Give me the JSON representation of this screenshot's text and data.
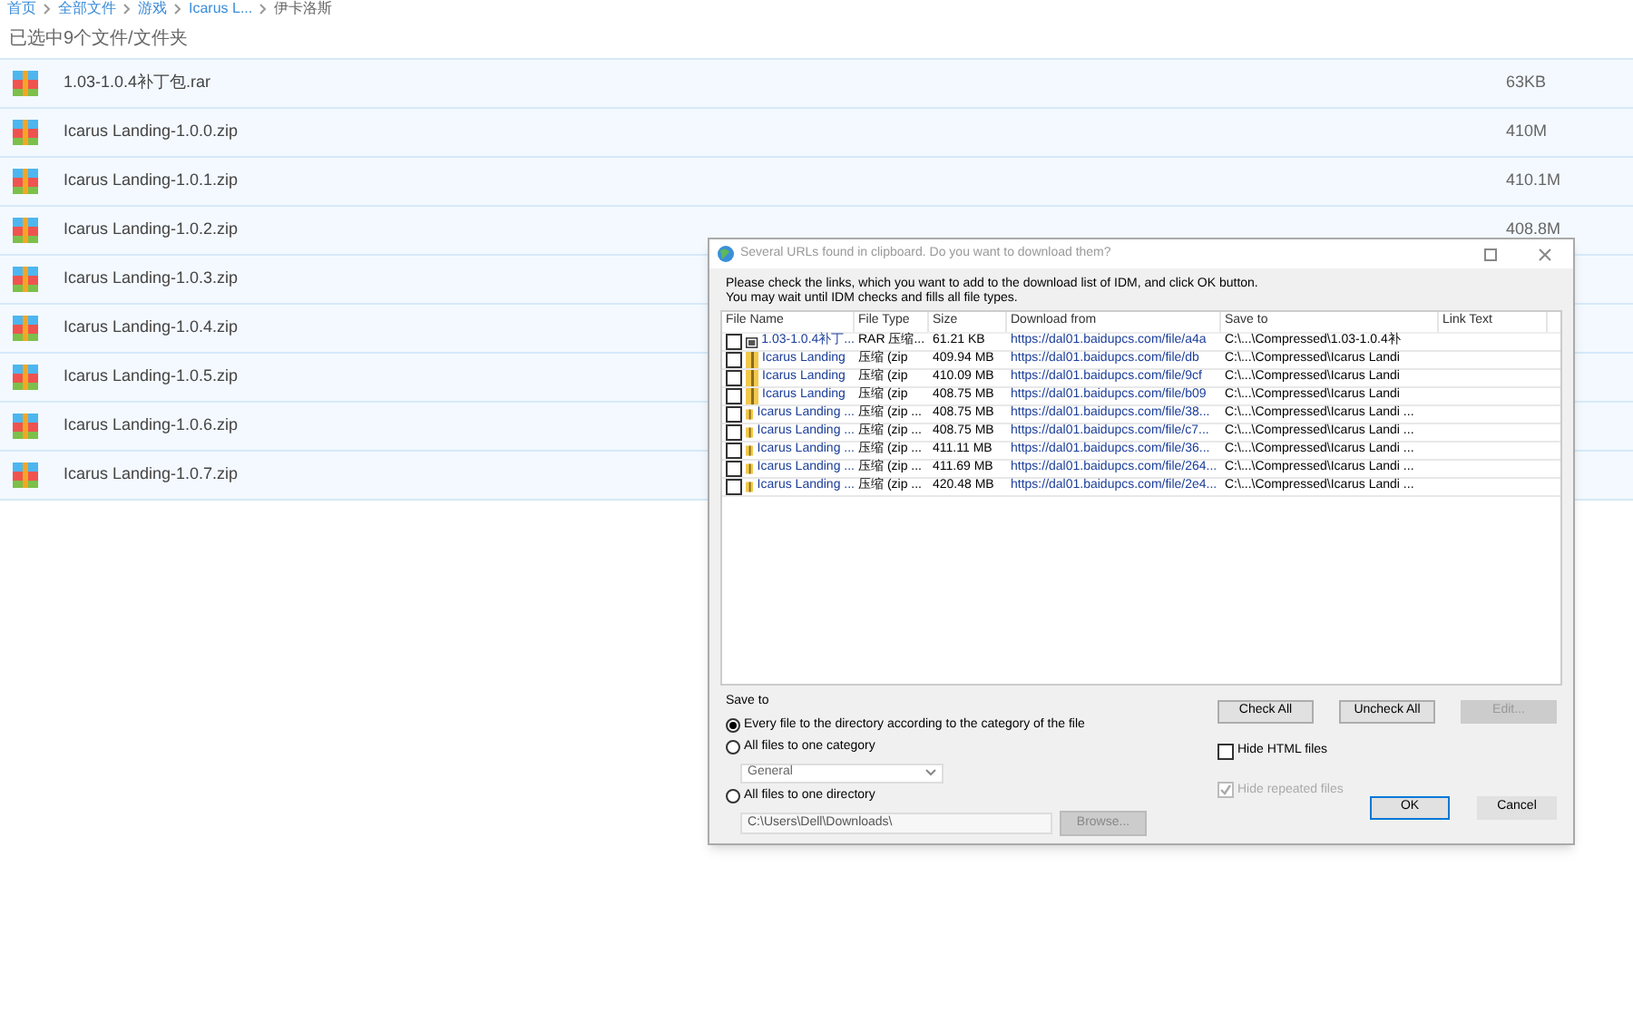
{
  "breadcrumb": [
    "首页",
    "全部文件",
    "游戏",
    "Icarus L...",
    "伊卡洛斯"
  ],
  "status": "已选中9个文件/文件夹",
  "files": [
    {
      "name": "1.03-1.0.4补丁包.rar",
      "size": "63KB"
    },
    {
      "name": "Icarus Landing-1.0.0.zip",
      "size": "410M"
    },
    {
      "name": "Icarus Landing-1.0.1.zip",
      "size": "410.1M"
    },
    {
      "name": "Icarus Landing-1.0.2.zip",
      "size": "408.8M"
    },
    {
      "name": "Icarus Landing-1.0.3.zip"
    },
    {
      "name": "Icarus Landing-1.0.4.zip"
    },
    {
      "name": "Icarus Landing-1.0.5.zip"
    },
    {
      "name": "Icarus Landing-1.0.6.zip"
    },
    {
      "name": "Icarus Landing-1.0.7.zip"
    }
  ],
  "dialog": {
    "title": "Several URLs found in clipboard. Do you want to download them?",
    "instructions": [
      "Please check the links, which you want to add to the download list of IDM, and click OK button.",
      "You may wait until IDM checks and fills all file types."
    ],
    "columns": [
      "File Name",
      "File Type",
      "Size",
      "Download from",
      "Save to",
      "Link Text"
    ],
    "rows": [
      {
        "kind": "rar",
        "checked": false,
        "cells": [
          "1.03-1.0.4补丁...",
          "RAR 压缩...",
          "61.21 KB",
          "https://dal01.baidupcs.com/file/a4a",
          "C:\\...\\Compressed\\1.03-1.0.4补"
        ]
      },
      {
        "kind": "zip",
        "checked": false,
        "cells": [
          "Icarus Landing",
          "压缩 (zip",
          "409.94 MB",
          "https://dal01.baidupcs.com/file/db",
          "C:\\...\\Compressed\\Icarus Landi"
        ]
      },
      {
        "kind": "zip",
        "checked": false,
        "cells": [
          "Icarus Landing",
          "压缩 (zip",
          "410.09 MB",
          "https://dal01.baidupcs.com/file/9cf",
          "C:\\...\\Compressed\\Icarus Landi"
        ]
      },
      {
        "kind": "zip",
        "checked": false,
        "cells": [
          "Icarus Landing",
          "压缩 (zip",
          "408.75 MB",
          "https://dal01.baidupcs.com/file/b09",
          "C:\\...\\Compressed\\Icarus Landi"
        ]
      },
      {
        "kind": "zip",
        "checked": false,
        "cells": [
          "Icarus Landing ...",
          "压缩 (zip ...",
          "408.75 MB",
          "https://dal01.baidupcs.com/file/38...",
          "C:\\...\\Compressed\\Icarus Landi ..."
        ]
      },
      {
        "kind": "zip",
        "checked": false,
        "cells": [
          "Icarus Landing ...",
          "压缩 (zip ...",
          "408.75 MB",
          "https://dal01.baidupcs.com/file/c7...",
          "C:\\...\\Compressed\\Icarus Landi ..."
        ]
      },
      {
        "kind": "zip",
        "checked": false,
        "cells": [
          "Icarus Landing ...",
          "压缩 (zip ...",
          "411.11 MB",
          "https://dal01.baidupcs.com/file/36...",
          "C:\\...\\Compressed\\Icarus Landi ..."
        ]
      },
      {
        "kind": "zip",
        "checked": false,
        "cells": [
          "Icarus Landing ...",
          "压缩 (zip ...",
          "411.69 MB",
          "https://dal01.baidupcs.com/file/264...",
          "C:\\...\\Compressed\\Icarus Landi ..."
        ]
      },
      {
        "kind": "zip",
        "checked": false,
        "cells": [
          "Icarus Landing ...",
          "压缩 (zip ...",
          "420.48 MB",
          "https://dal01.baidupcs.com/file/2e4...",
          "C:\\...\\Compressed\\Icarus Landi ..."
        ]
      }
    ],
    "save_to_label": "Save to",
    "options": [
      {
        "label": "Every file to the directory according to the category of the file",
        "selected": true
      },
      {
        "label": "All files to one category",
        "selected": false
      },
      {
        "label": "All files to one directory",
        "selected": false
      }
    ],
    "category": "General",
    "directory": "C:\\Users\\Dell\\Downloads\\",
    "browse": "Browse...",
    "buttons": [
      {
        "label": "Check All",
        "disabled": false
      },
      {
        "label": "Uncheck All",
        "disabled": false
      },
      {
        "label": "Edit...",
        "disabled": true
      }
    ],
    "checkboxes": [
      {
        "label": "Hide HTML files",
        "checked": false,
        "disabled": false
      },
      {
        "label": "Hide repeated files",
        "checked": true,
        "disabled": true
      }
    ],
    "ok": "OK",
    "cancel": "Cancel"
  }
}
